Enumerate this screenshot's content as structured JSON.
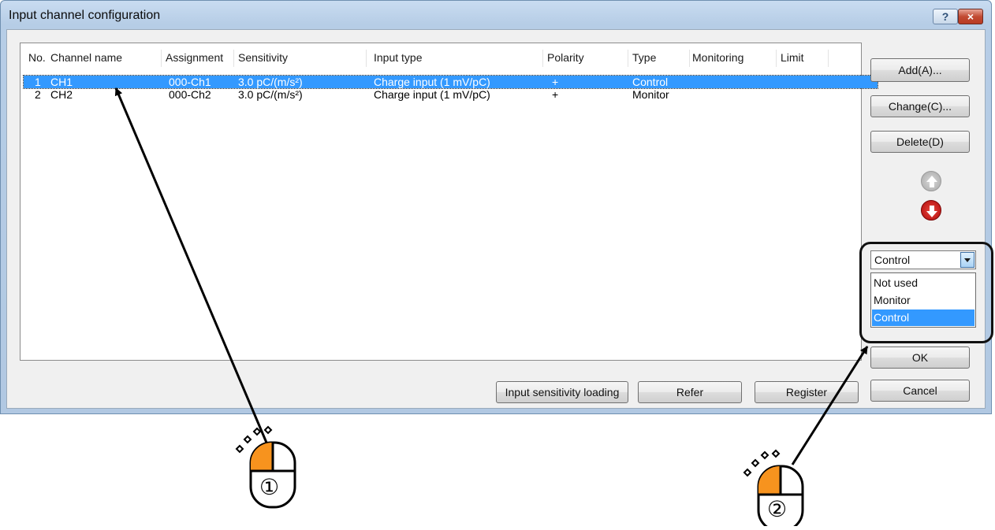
{
  "window": {
    "title": "Input channel configuration",
    "help_label": "?",
    "close_label": "×"
  },
  "columns": [
    "No.",
    "Channel name",
    "Assignment",
    "Sensitivity",
    "Input type",
    "Polarity",
    "Type",
    "Monitoring",
    "Limit"
  ],
  "rows": [
    {
      "no": "1",
      "name": "CH1",
      "assignment": "000-Ch1",
      "sensitivity": "3.0 pC/(m/s²)",
      "input_type": "Charge input (1 mV/pC)",
      "polarity": "+",
      "type": "Control",
      "monitoring": "",
      "limit": "",
      "selected": true
    },
    {
      "no": "2",
      "name": "CH2",
      "assignment": "000-Ch2",
      "sensitivity": "3.0 pC/(m/s²)",
      "input_type": "Charge input (1 mV/pC)",
      "polarity": "+",
      "type": "Monitor",
      "monitoring": "",
      "limit": "",
      "selected": false
    }
  ],
  "buttons": {
    "add": "Add(A)...",
    "change": "Change(C)...",
    "delete": "Delete(D)",
    "ok": "OK",
    "cancel": "Cancel",
    "input_sensitivity_loading": "Input sensitivity loading",
    "refer": "Refer",
    "register": "Register"
  },
  "type_combo": {
    "value": "Control",
    "options": [
      "Not used",
      "Monitor",
      "Control"
    ],
    "highlighted": "Control"
  },
  "annotations": {
    "mouse1_label": "①",
    "mouse2_label": "②"
  },
  "colors": {
    "selection": "#3399ff",
    "mouse_button": "#f7931e",
    "arrow_down": "#c8100f"
  }
}
